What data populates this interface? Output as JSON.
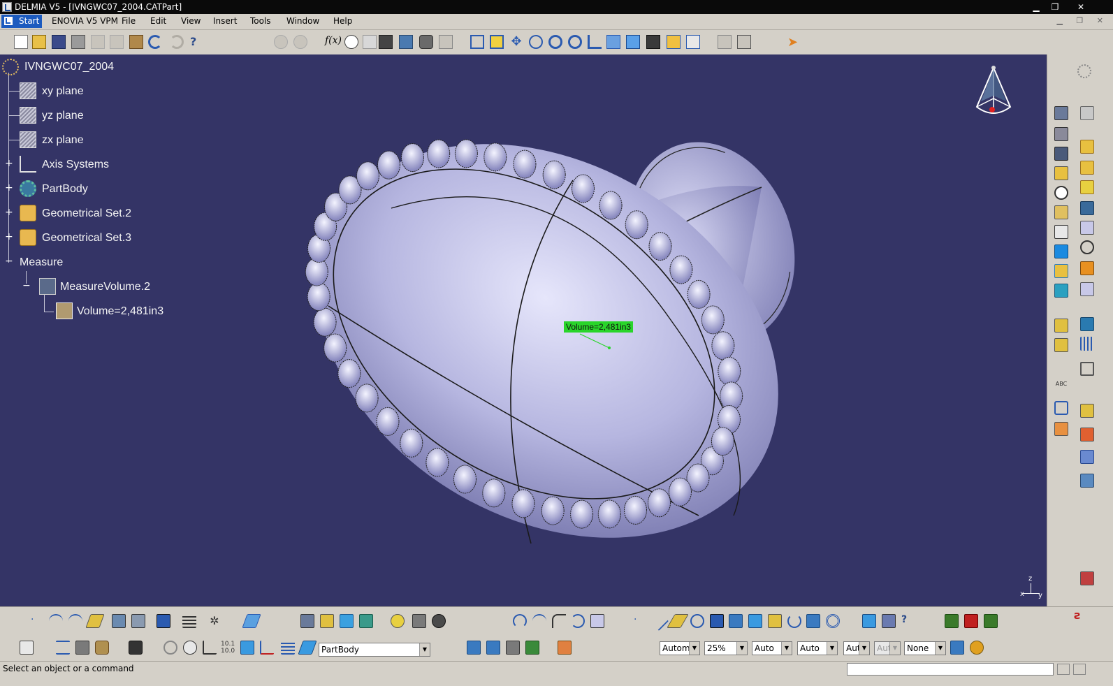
{
  "window": {
    "title": "DELMIA V5 - [IVNGWC07_2004.CATPart]",
    "controls": {
      "minimize": "▁",
      "restore": "❐",
      "close": "✕"
    }
  },
  "menubar": {
    "start": "Start",
    "items": [
      "ENOVIA V5 VPM",
      "File",
      "Edit",
      "View",
      "Insert",
      "Tools",
      "Window",
      "Help"
    ]
  },
  "tree": {
    "root": "IVNGWC07_2004",
    "nodes": [
      {
        "label": "xy plane",
        "icon": "plane-icon"
      },
      {
        "label": "yz plane",
        "icon": "plane-icon"
      },
      {
        "label": "zx plane",
        "icon": "plane-icon"
      },
      {
        "label": "Axis Systems",
        "icon": "axis-system-icon"
      },
      {
        "label": "PartBody",
        "icon": "partbody-gear-icon"
      },
      {
        "label": "Geometrical Set.2",
        "icon": "geometrical-set-icon"
      },
      {
        "label": "Geometrical Set.3",
        "icon": "geometrical-set-icon"
      },
      {
        "label": "Measure",
        "icon": ""
      },
      {
        "label": "MeasureVolume.2",
        "icon": "measure-volume-icon"
      },
      {
        "label": "Volume=2,481in3",
        "icon": "volume-parameter-icon"
      }
    ]
  },
  "viewport": {
    "measure_label": "Volume=2,481in3",
    "background": "#343466",
    "model_color": "#b8b8e8"
  },
  "axis_indicator": {
    "z": "z",
    "x": "x",
    "y": "y"
  },
  "bottom": {
    "current_body": "PartBody",
    "combos": [
      "Automa",
      "25%",
      "Auto",
      "Auto",
      "Aut",
      "Aut",
      "None"
    ]
  },
  "status": {
    "message": "Select an object or a command"
  },
  "colors": {
    "titlebar": "#0a0a0a",
    "chrome": "#d4d0c8",
    "start_button": "#1c5bbf",
    "measure_tag": "#29d52a"
  }
}
